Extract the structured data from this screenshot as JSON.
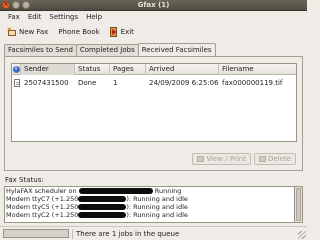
{
  "window": {
    "title": "Gfax (1)"
  },
  "menu": [
    "Fax",
    "Edit",
    "Settings",
    "Help"
  ],
  "toolbar": {
    "new_fax": "New Fax",
    "phone_book": "Phone Book",
    "exit": "Exit"
  },
  "tabs": [
    "Facsimiles to Send",
    "Completed Jobs",
    "Received Facsimiles"
  ],
  "active_tab": 2,
  "table": {
    "columns": [
      "Sender",
      "Status",
      "Pages",
      "Arrived",
      "Filename"
    ],
    "rows": [
      {
        "sender": "2507431500",
        "status": "Done",
        "pages": "1",
        "arrived": "24/09/2009 6:25:06 PM",
        "filename": "fax000000119.tif"
      }
    ]
  },
  "buttons": {
    "view_print": "View / Print",
    "delete": "Delete"
  },
  "fax_status": {
    "label": "Fax Status:",
    "lines": [
      {
        "before": "HylaFAX scheduler on",
        "after": "Running"
      },
      {
        "before": "Modem ttyC7 (+1.250",
        "after": "): Running and idle"
      },
      {
        "before": "Modem ttyC5 (+1.250",
        "after": "): Running and idle"
      },
      {
        "before": "Modem ttyC2 (+1.250",
        "after": "): Running and idle"
      }
    ]
  },
  "statusbar": {
    "text": "There are 1 jobs in the queue",
    "progress": 0
  },
  "colors": {
    "title_bg": "#5a5449",
    "close_button": "#e7692e",
    "window_bg": "#efebe7"
  }
}
